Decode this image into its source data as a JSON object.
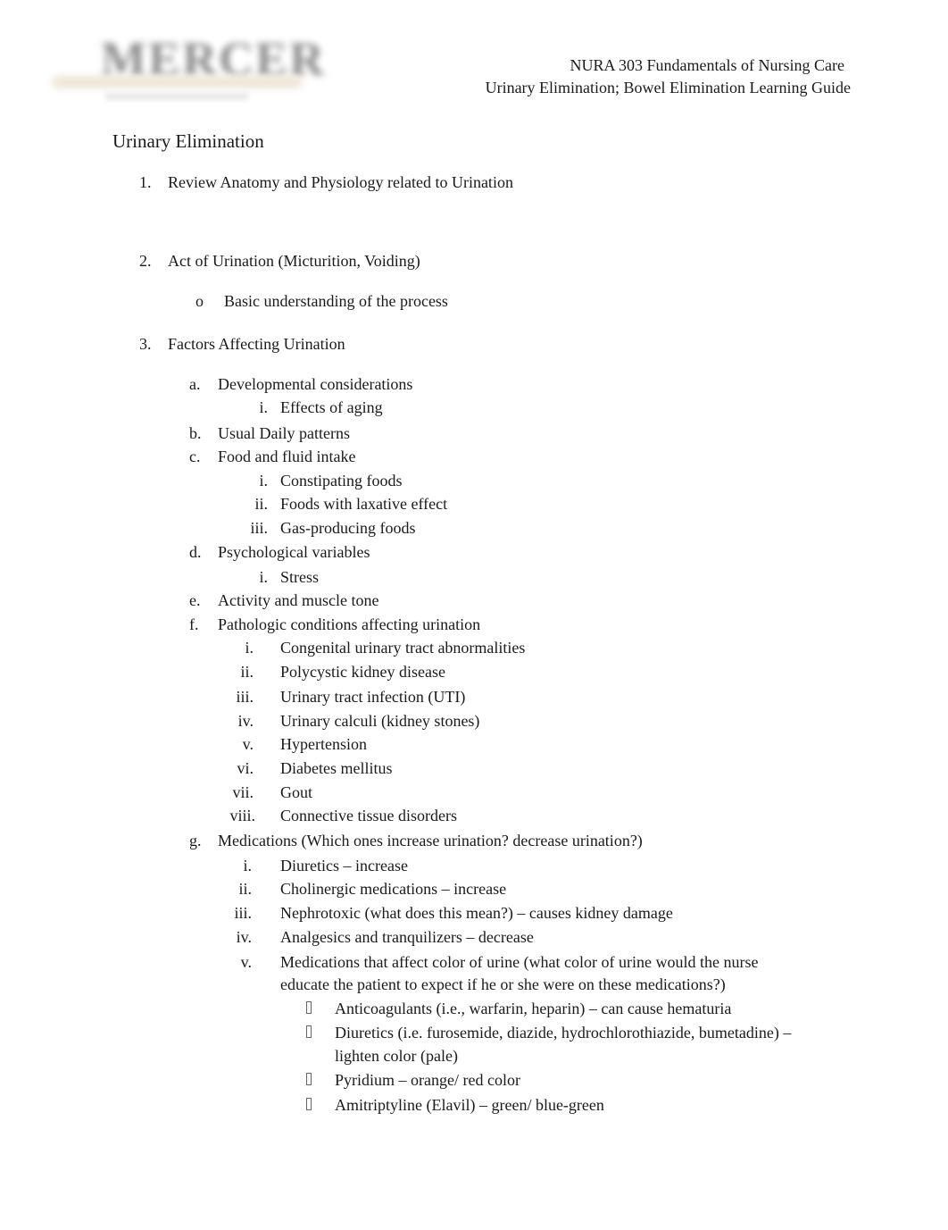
{
  "header": {
    "logo_alt": "MERCER",
    "course": "NURA 303 Fundamentals of Nursing Care",
    "guide_title": "Urinary Elimination; Bowel Elimination Learning Guide"
  },
  "section_title": "Urinary Elimination",
  "items": [
    {
      "marker": "1.",
      "text": "Review Anatomy and Physiology related to Urination"
    },
    {
      "marker": "2.",
      "text": "Act of Urination (Micturition, Voiding)",
      "sub": [
        {
          "marker": "o",
          "text": "Basic understanding of the process"
        }
      ]
    },
    {
      "marker": "3.",
      "text": "Factors Affecting Urination",
      "sub": [
        {
          "marker": "a.",
          "text": "Developmental considerations",
          "sub": [
            {
              "marker": "i.",
              "text": "Effects of aging"
            }
          ]
        },
        {
          "marker": "b.",
          "text": "Usual Daily patterns"
        },
        {
          "marker": "c.",
          "text": "Food and fluid intake",
          "sub": [
            {
              "marker": "i.",
              "text": "Constipating foods"
            },
            {
              "marker": "ii.",
              "text": "Foods with laxative effect"
            },
            {
              "marker": "iii.",
              "text": "Gas-producing foods"
            }
          ]
        },
        {
          "marker": "d.",
          "text": "Psychological variables",
          "sub": [
            {
              "marker": "i.",
              "text": "Stress"
            }
          ]
        },
        {
          "marker": "e.",
          "text": "Activity and muscle tone"
        },
        {
          "marker": "f.",
          "text": "Pathologic conditions affecting urination",
          "sub": [
            {
              "marker": "i.",
              "text": "Congenital urinary tract abnormalities"
            },
            {
              "marker": "ii.",
              "text": "Polycystic kidney disease"
            },
            {
              "marker": "iii.",
              "text": "Urinary tract infection (UTI)"
            },
            {
              "marker": "iv.",
              "text": "Urinary calculi (kidney stones)"
            },
            {
              "marker": "v.",
              "text": "Hypertension"
            },
            {
              "marker": "vi.",
              "text": "Diabetes mellitus"
            },
            {
              "marker": "vii.",
              "text": "Gout"
            },
            {
              "marker": "viii.",
              "text": "Connective tissue disorders"
            }
          ]
        },
        {
          "marker": "g.",
          "text": "Medications (Which ones increase urination? decrease urination?)",
          "sub": [
            {
              "marker": "i.",
              "text": "Diuretics – increase"
            },
            {
              "marker": "ii.",
              "text": "Cholinergic medications – increase"
            },
            {
              "marker": "iii.",
              "text": "Nephrotoxic (what does this mean?) – causes kidney damage"
            },
            {
              "marker": "iv.",
              "text": "Analgesics and tranquilizers – decrease"
            },
            {
              "marker": "v.",
              "text_line1": "Medications that affect color of urine (what color of urine would the nurse",
              "text_line2": "educate the patient to expect if he or she were on these medications?)",
              "sub": [
                {
                  "marker": "missing-glyph-bullet",
                  "text": "Anticoagulants (i.e., warfarin, heparin) – can cause hematuria"
                },
                {
                  "marker": "missing-glyph-bullet",
                  "text_line1": "Diuretics (i.e. furosemide, diazide, hydrochlorothiazide, bumetadine) –",
                  "text_line2": "lighten color (pale)"
                },
                {
                  "marker": "missing-glyph-bullet",
                  "text": "Pyridium – orange/ red color"
                },
                {
                  "marker": "missing-glyph-bullet",
                  "text": "Amitriptyline (Elavil) – green/ blue-green"
                }
              ]
            }
          ]
        }
      ]
    }
  ]
}
